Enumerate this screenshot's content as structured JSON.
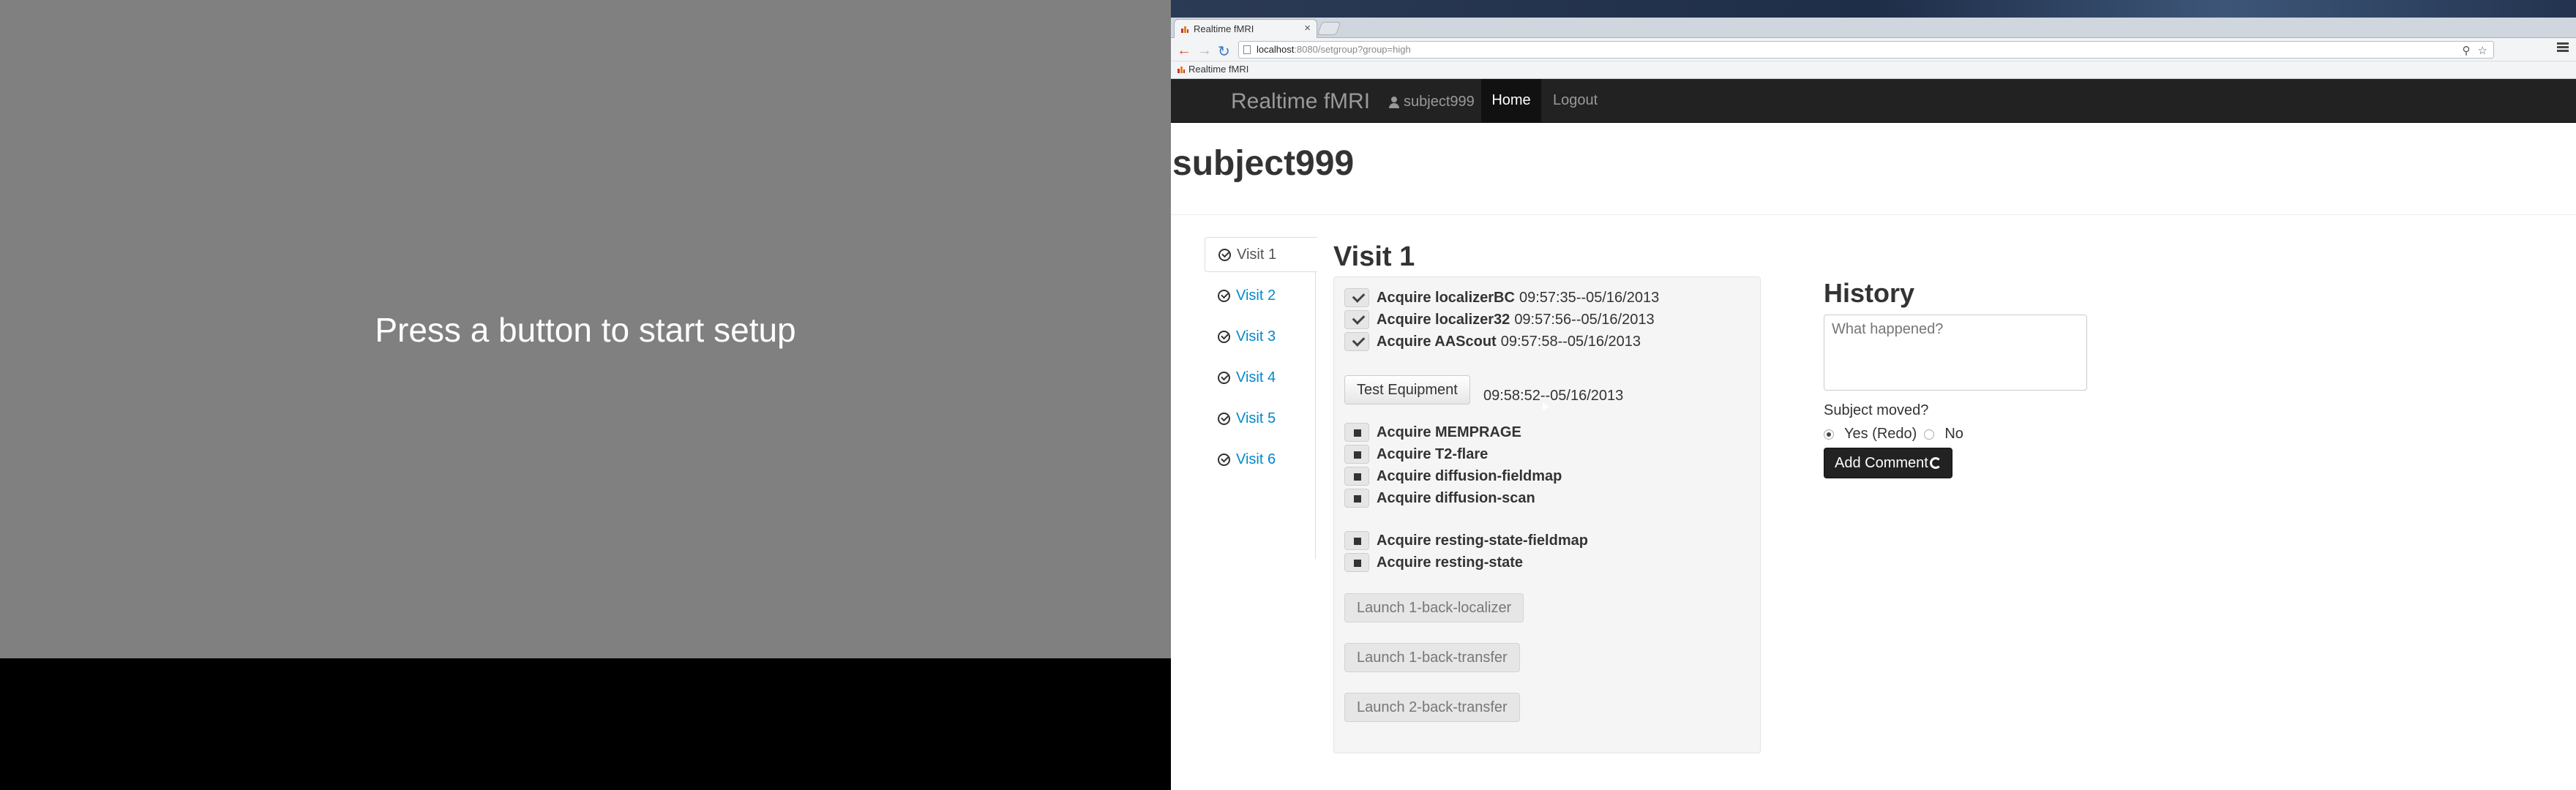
{
  "stimulus": {
    "message": "Press a button to start setup"
  },
  "browser": {
    "tab_title": "Realtime fMRI",
    "url_host": "localhost",
    "url_path": ":8080/setgroup?group=high",
    "bookmark": "Realtime fMRI"
  },
  "navbar": {
    "brand": "Realtime fMRI",
    "user": "subject999",
    "home": "Home",
    "logout": "Logout"
  },
  "page_title": "subject999",
  "visits": [
    "Visit 1",
    "Visit 2",
    "Visit 3",
    "Visit 4",
    "Visit 5",
    "Visit 6"
  ],
  "visit_title": "Visit 1",
  "acquired": [
    {
      "name": "Acquire localizerBC",
      "ts": "09:57:35--05/16/2013"
    },
    {
      "name": "Acquire localizer32",
      "ts": "09:57:56--05/16/2013"
    },
    {
      "name": "Acquire AAScout",
      "ts": "09:57:58--05/16/2013"
    }
  ],
  "test_equipment": {
    "label": "Test Equipment",
    "ts": "09:58:52--05/16/2013"
  },
  "pending_group1": [
    "Acquire MEMPRAGE",
    "Acquire T2-flare",
    "Acquire diffusion-fieldmap",
    "Acquire diffusion-scan"
  ],
  "pending_group2": [
    "Acquire resting-state-fieldmap",
    "Acquire resting-state"
  ],
  "launch_buttons": [
    "Launch 1-back-localizer",
    "Launch 1-back-transfer",
    "Launch 2-back-transfer"
  ],
  "history": {
    "title": "History",
    "placeholder": "What happened?",
    "moved_label": "Subject moved?",
    "yes_label": "Yes (Redo)",
    "no_label": "No",
    "add_label": "Add Comment"
  }
}
